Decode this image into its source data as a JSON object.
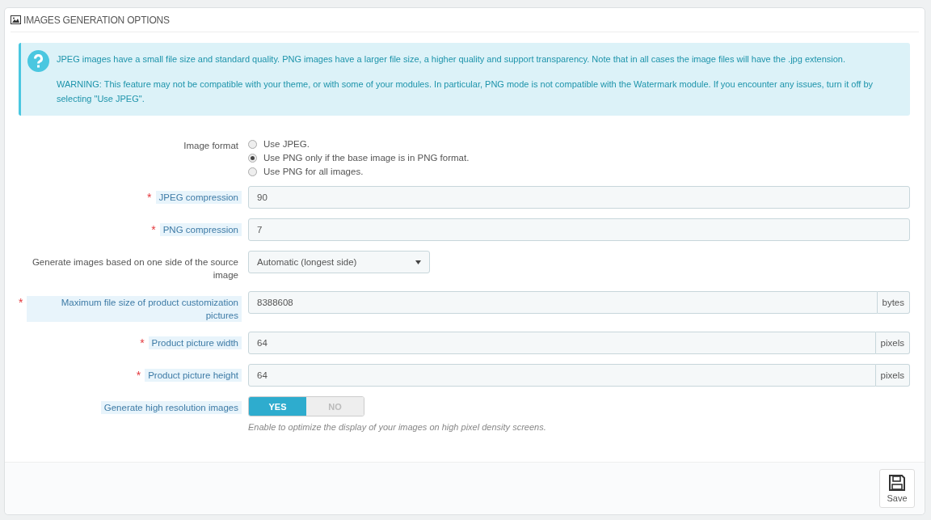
{
  "panel": {
    "title": "IMAGES GENERATION OPTIONS"
  },
  "alert": {
    "paragraphs": [
      "JPEG images have a small file size and standard quality. PNG images have a larger file size, a higher quality and support transparency. Note that in all cases the image files will have the .jpg extension.",
      "WARNING: This feature may not be compatible with your theme, or with some of your modules. In particular, PNG mode is not compatible with the Watermark module. If you encounter any issues, turn it off by selecting \"Use JPEG\"."
    ]
  },
  "fields": [
    {
      "kind": "radio",
      "label": "Image format",
      "hint": false,
      "options": [
        {
          "label": "Use JPEG.",
          "selected": false
        },
        {
          "label": "Use PNG only if the base image is in PNG format.",
          "selected": true
        },
        {
          "label": "Use PNG for all images.",
          "selected": false
        }
      ]
    },
    {
      "kind": "text",
      "label": "JPEG compression",
      "required_mark": "*",
      "hint": true,
      "value": "90"
    },
    {
      "kind": "text",
      "label": "PNG compression",
      "required_mark": "*",
      "hint": true,
      "value": "7"
    },
    {
      "kind": "select",
      "label": "Generate images based on one side of the source image",
      "hint": false,
      "value": "Automatic (longest side)"
    },
    {
      "kind": "text",
      "label": "Maximum file size of product customization pictures",
      "required_mark": "*",
      "hint": true,
      "value": "8388608",
      "suffix": "bytes"
    },
    {
      "kind": "text",
      "label": "Product picture width",
      "required_mark": "*",
      "hint": true,
      "value": "64",
      "suffix": "pixels"
    },
    {
      "kind": "text",
      "label": "Product picture height",
      "required_mark": "*",
      "hint": true,
      "value": "64",
      "suffix": "pixels"
    },
    {
      "kind": "switch",
      "label": "Generate high resolution images",
      "hint": true,
      "on": true,
      "yes": "YES",
      "no": "NO",
      "help": "Enable to optimize the display of your images on high pixel density screens."
    }
  ],
  "footer": {
    "save": "Save"
  }
}
